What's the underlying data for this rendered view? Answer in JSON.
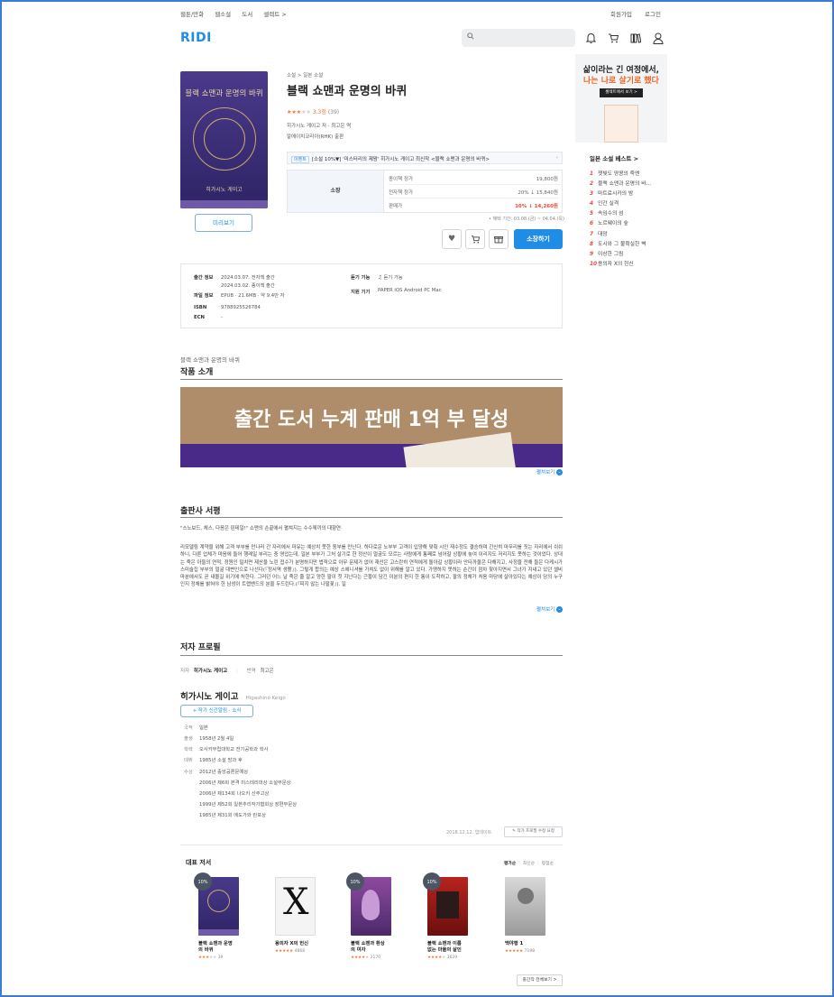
{
  "topnav": {
    "items": [
      "웹툰/만화",
      "웹소설",
      "도서",
      "셀렉트 >"
    ],
    "signup": "회원가입",
    "login": "로그인"
  },
  "header": {
    "logo": "RIDI"
  },
  "book": {
    "cover_title": "블랙 쇼맨과 운명의 바퀴",
    "cover_author": "히가시노 게이고",
    "preview_btn": "미리보기",
    "breadcrumb": "소설 > 일본 소설",
    "title": "블랙 쇼맨과 운명의 바퀴",
    "rating_value": "3.3점",
    "rating_count": "(39)",
    "rating_stars": 3.3,
    "authors": "히가시노 게이고 저 · 최고은 역",
    "publisher": "알에이치코리아(RHK) 출판",
    "event_tag": "이벤트",
    "event_text": "[소설 10%▼] '미스터리의 제왕' 히가시노 게이고 최신작 <블랙 쇼맨과 운명의 바퀴>",
    "price_label": "소장",
    "prices": [
      {
        "k": "종이책 정가",
        "v": "19,800원"
      },
      {
        "k": "전자책 정가",
        "v": "20% ↓ 15,840원"
      },
      {
        "k": "판매가",
        "v": "10% ↓ 14,260원"
      }
    ],
    "price_note": "• 혜택 기간: 03.08.(금) ~ 04.04.(목)",
    "buy_btn": "소장하기"
  },
  "info": {
    "pub_label": "출간 정보",
    "pub_v1": "2024.03.07. 전자책 출간",
    "pub_v2": "2024.03.02. 종이책 출간",
    "file_label": "파일 정보",
    "file_v": "EPUB · 21.6MB · 약 9.4만 자",
    "isbn_label": "ISBN",
    "isbn_v": "9788925526784",
    "ecn_label": "ECN",
    "ecn_v": "-",
    "listen_label": "듣기 기능",
    "listen_v": "듣기 가능",
    "device_label": "지원 기기",
    "device_v": "PAPER  iOS  Android  PC  Mac"
  },
  "intro": {
    "subtitle": "블랙 쇼맨과 운명의 바퀴",
    "title": "작품 소개",
    "banner_text": "출간 도서 누계 판매 1억 부 달성",
    "more": "펼쳐보기"
  },
  "publisher_review": {
    "title": "출판사 서평",
    "quote": "\"스노보드, 체스, 다음은 핀테일!\" 쇼맨의 손끝에서 펼쳐지는 수수께끼의 대향연",
    "body": "리모델링 계약을 위해 고객 부부를 만나러 간 자리에서 마유는 예상치 못한 동부를 만난다. 하다로운 노부부 고객이 입양해 맞춰 시인 재수정도 결승하며 간신히 마무리를 짓는 자리에서 쉬쉬하니, 다른 업체가 마음에 들어 행레일 부리는 중 영업는데, 일본 부부가 그처 살기로 한 정산이 얼굴도 모르는 사람에게 통째로 넘어갈 상황에 놓여 이리지도 저리지도 못하는 것이었다. 상대는 죽은 아들의 연적, 정원인 밀치면 제산을 노린 접수가 분명하지만 법적으로 아무 문제가 없어 재산은 고스란히 연적에게 돌아갈 상황이라 안타까울은 다해지고, 사정을 전해 들은 다케시가 스미술집 부부의 얼굴 대변인으로 나선다(『정서역 생활』). 그렇게 합의는 예상 스에니셔를 가쳐도 없이 위해를 알고 있다. 가맹하지 못하는 순간이 점차 찾아지면서 그녀가 지내고 있던 셀비마분에서도 곧 내몰길 위기에 처한다. 그러던 어느 날 죽은 줄 알고 양한 팔이 첫 지난다는 근황이 담긴 이분의 편지 한 통이 도착하고, 팔의 정체가 처음 마당에 살아있다는 예상이 당의 누구인지 정체를 밝혀야 한 남성이 트랩밴드의 분을 두드린다.(『피지 않는 나팔꽃』). 일",
    "more": "펼쳐보기"
  },
  "author_profile": {
    "title": "저자 프로필",
    "tab1_k": "저자",
    "tab1_v": "히가시노 게이고",
    "tab2_k": "번역",
    "tab2_v": "최고은",
    "name": "히가시노 게이고",
    "name_en": "Higashino Keigo",
    "follow_btn": "+ 작가 신간알림 · 소식",
    "details": [
      {
        "k": "국적",
        "v": "일본"
      },
      {
        "k": "출생",
        "v": "1958년 2월 4일"
      },
      {
        "k": "학력",
        "v": "오사카부립대학교 전기공학과 학사"
      },
      {
        "k": "데뷔",
        "v": "1985년 소설 방과 후"
      },
      {
        "k": "수상",
        "v": "2012년 중앙공론문예상"
      }
    ],
    "awards": [
      "2006년 제6회 본격 미스테리대상 소설부문상",
      "2006년 제134회 나오키 산주고상",
      "1999년 제52회 일본추리작가협회상 장편부문상",
      "1985년 제31회 에도가와 란포상"
    ],
    "updated": "2018.12.12. 업데이트",
    "edit_btn": "작가 프로필 수정 요청"
  },
  "works": {
    "title": "대표 저서",
    "sort": [
      "평가순",
      "최신순",
      "평점순"
    ],
    "items": [
      {
        "title1": "블랙 쇼맨과 운명",
        "title2": "의 바퀴",
        "rating": "39",
        "badge": "10%"
      },
      {
        "title1": "용의자 X의 헌신",
        "title2": "",
        "rating": "4868",
        "badge": ""
      },
      {
        "title1": "블랙 쇼맨과 환상",
        "title2": "의 여자",
        "rating": "2170",
        "badge": "10%"
      },
      {
        "title1": "블랙 쇼맨과 이름",
        "title2": "없는 마을의 살인",
        "rating": "3629",
        "badge": "10%"
      },
      {
        "title1": "백야행 1",
        "title2": "",
        "rating": "7198",
        "badge": ""
      }
    ],
    "all_btn": "출간작 전체보기 >"
  },
  "sidebar": {
    "ad_line1": "삶이라는 긴 여정에서,",
    "ad_line2": "나는 나로 살기로 했다",
    "ad_btn": "셀렉트에서 보기 >",
    "best_title": "일본 소설 베스트 >",
    "best": [
      "잿빛도 땅콩의 죽엔",
      "블랙 쇼맨과 운명의 바...",
      "마트료시카의 밤",
      "인간 실격",
      "속임수의 섬",
      "노르웨이의 숲",
      "대망",
      "도시와 그 불확실한 벽",
      "이상한 그림",
      "용의자 X의 헌신"
    ]
  }
}
